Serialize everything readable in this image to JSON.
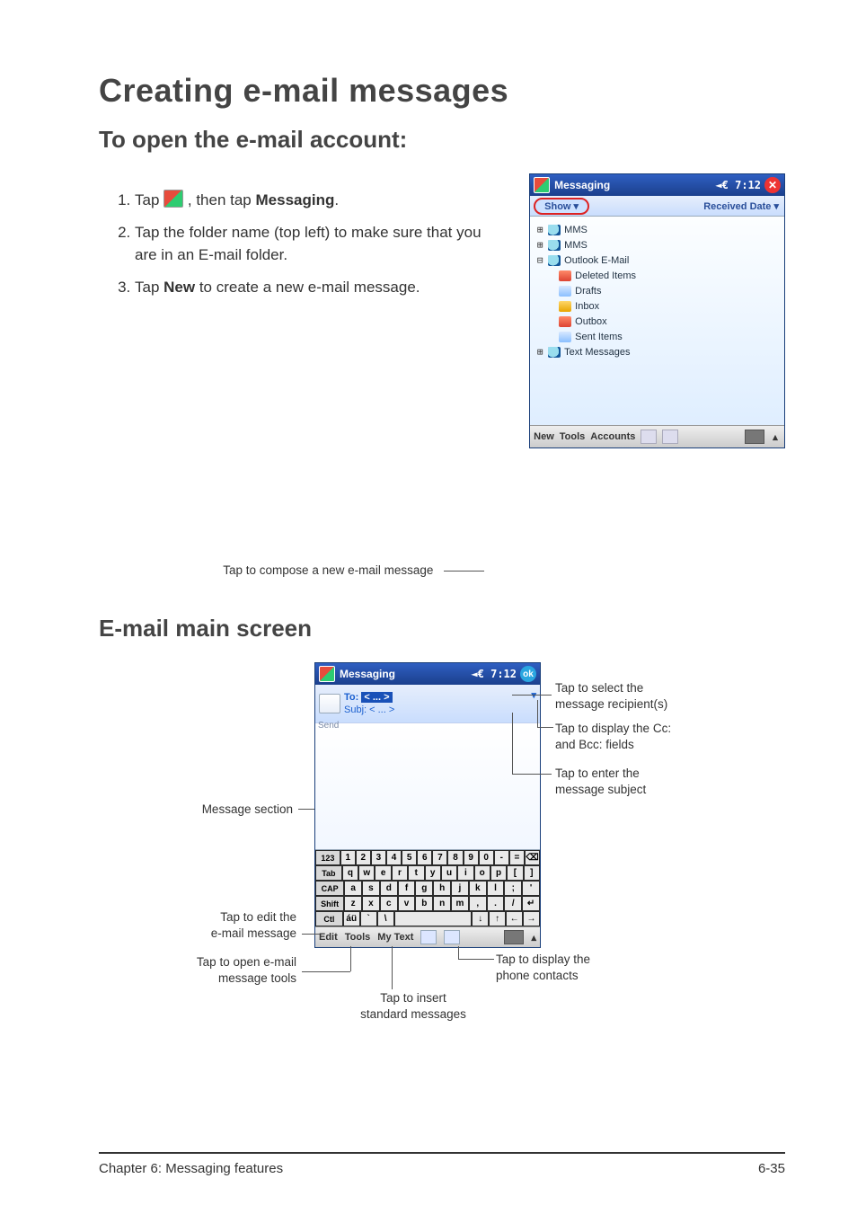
{
  "page": {
    "title": "Creating e-mail messages",
    "subtitle1": "To open the e-mail account:",
    "subtitle2": "E-mail main screen",
    "chapter": "Chapter 6: Messaging features",
    "pagenum": "6-35"
  },
  "steps": {
    "s1a": "Tap ",
    "s1b": ", then tap ",
    "s1_bold": "Messaging",
    "s1c": ".",
    "s2": "Tap the folder name (top left) to make sure that you are in an E-mail folder.",
    "s3a": "Tap ",
    "s3_bold": "New",
    "s3b": " to create a new e-mail message."
  },
  "caption1": "Tap to compose a new e-mail message",
  "shot1": {
    "title": "Messaging",
    "signal": "◄€ 7:12",
    "close": "✕",
    "show": "Show ▾",
    "received": "Received Date ▾",
    "tree": {
      "mms1": "MMS",
      "mms2": "MMS",
      "outlook": "Outlook E-Mail",
      "deleted": "Deleted Items",
      "drafts": "Drafts",
      "inbox": "Inbox",
      "outbox": "Outbox",
      "sent": "Sent Items",
      "text": "Text Messages"
    },
    "bot": {
      "new": "New",
      "tools": "Tools",
      "accounts": "Accounts",
      "up": "▴"
    }
  },
  "shot2": {
    "title": "Messaging",
    "signal": "◄€ 7:12",
    "ok": "ok",
    "send": "Send",
    "to": "To:",
    "to_hl": "< ... >",
    "subj": "Subj: < ... >",
    "dd": "▾",
    "kb": {
      "r1": [
        "123",
        "1",
        "2",
        "3",
        "4",
        "5",
        "6",
        "7",
        "8",
        "9",
        "0",
        "-",
        "=",
        "⌫"
      ],
      "r2": [
        "Tab",
        "q",
        "w",
        "e",
        "r",
        "t",
        "y",
        "u",
        "i",
        "o",
        "p",
        "[",
        "]"
      ],
      "r3": [
        "CAP",
        "a",
        "s",
        "d",
        "f",
        "g",
        "h",
        "j",
        "k",
        "l",
        ";",
        "'"
      ],
      "r4": [
        "Shift",
        "z",
        "x",
        "c",
        "v",
        "b",
        "n",
        "m",
        ",",
        ".",
        "/",
        "↵"
      ],
      "r5": [
        "Ctl",
        "áü",
        "`",
        "\\",
        " ",
        "↓",
        "↑",
        "←",
        "→"
      ]
    },
    "bot": {
      "edit": "Edit",
      "tools": "Tools",
      "mytext": "My Text",
      "up": "▴"
    }
  },
  "ann": {
    "msg_section": "Message section",
    "edit_msg": "Tap to edit the\ne-mail message",
    "open_tools": "Tap to open e-mail\nmessage tools",
    "insert_std": "Tap to insert\nstandard messages",
    "disp_contacts": "Tap to display the\nphone contacts",
    "sel_recip": "Tap to select the\nmessage recipient(s)",
    "disp_cc": "Tap to display the Cc:\nand Bcc: fields",
    "enter_subj": "Tap to enter the\nmessage subject"
  }
}
